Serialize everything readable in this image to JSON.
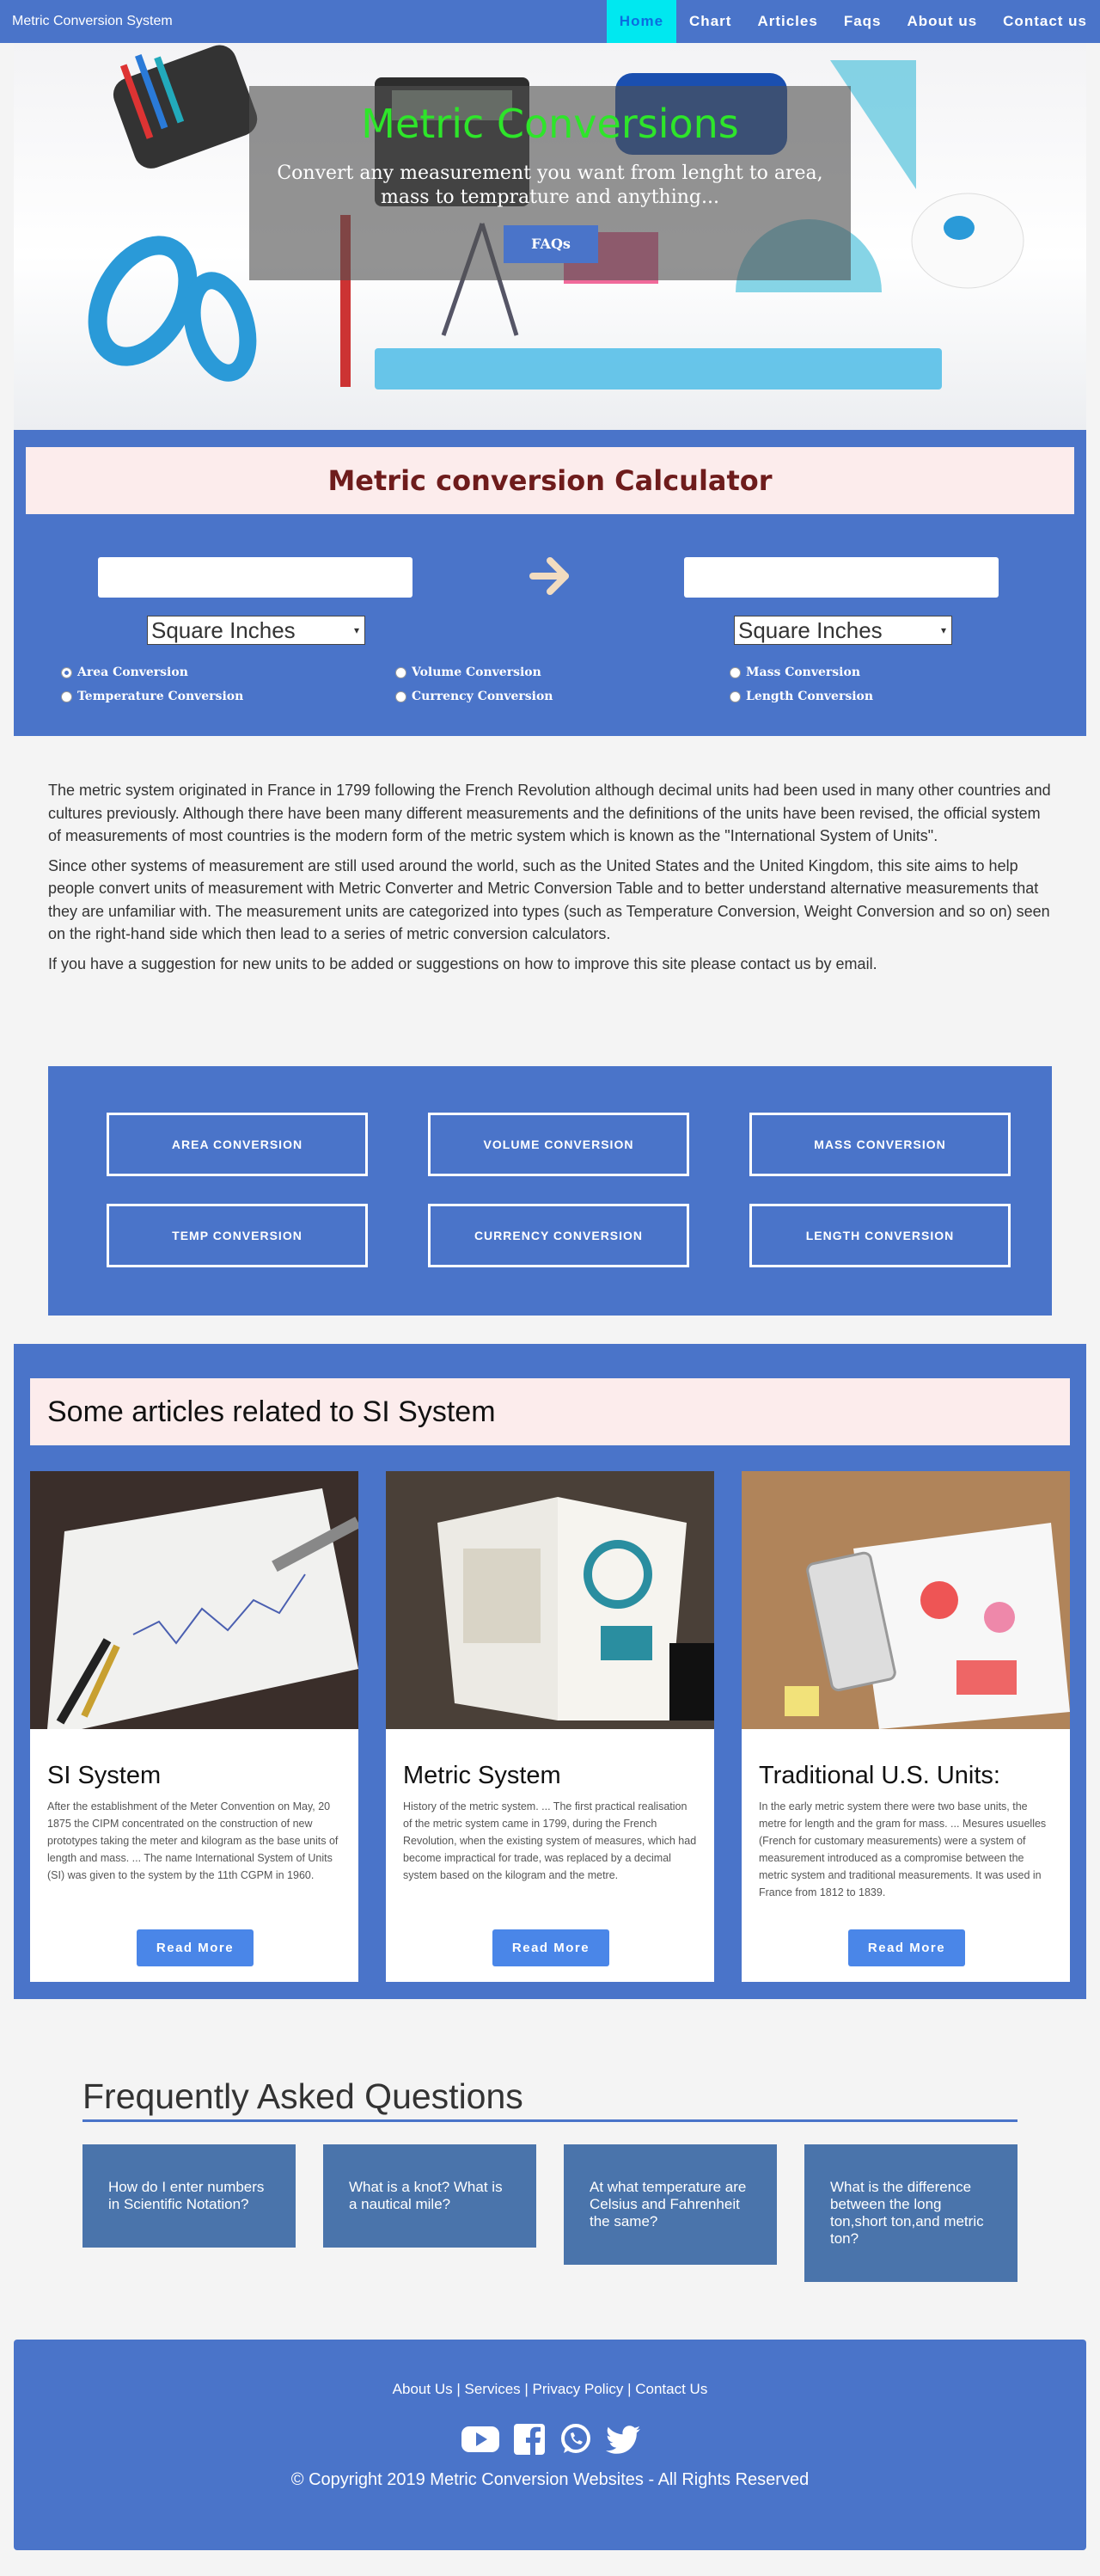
{
  "nav": {
    "brand": "Metric Conversion System",
    "links": [
      "Home",
      "Chart",
      "Articles",
      "Faqs",
      "About us",
      "Contact us"
    ]
  },
  "hero": {
    "title": "Metric Conversions",
    "subtitle_line1": "Convert any measurement you want from lenght to area,",
    "subtitle_line2": "mass to temprature and anything...",
    "button": "FAQs"
  },
  "calculator": {
    "title": "Metric conversion Calculator",
    "from_value": "",
    "to_value": "",
    "from_unit": "Square Inches",
    "to_unit": "Square Inches",
    "options": [
      {
        "label": "Area Conversion",
        "selected": true
      },
      {
        "label": "Volume Conversion",
        "selected": false
      },
      {
        "label": "Mass Conversion",
        "selected": false
      },
      {
        "label": "Temperature Conversion",
        "selected": false
      },
      {
        "label": "Currency Conversion",
        "selected": false
      },
      {
        "label": "Length Conversion",
        "selected": false
      }
    ]
  },
  "intro": {
    "p1": "The metric system originated in France in 1799 following the French Revolution although decimal units had been used in many other countries and cultures previously. Although there have been many different measurements and the definitions of the units have been revised, the official system of measurements of most countries is the modern form of the metric system which is known as the \"International System of Units\".",
    "p2": "Since other systems of measurement are still used around the world, such as the United States and the United Kingdom, this site aims to help people convert units of measurement with Metric Converter and Metric Conversion Table and to better understand alternative measurements that they are unfamiliar with. The measurement units are categorized into types (such as Temperature Conversion, Weight Conversion and so on) seen on the right-hand side which then lead to a series of metric conversion calculators.",
    "p3": "If you have a suggestion for new units to be added or suggestions on how to improve this site please contact us by email."
  },
  "conversions": [
    "AREA CONVERSION",
    "VOLUME CONVERSION",
    "MASS CONVERSION",
    "TEMP CONVERSION",
    "CURRENCY CONVERSION",
    "LENGTH CONVERSION"
  ],
  "articles": {
    "heading": "Some articles related to SI System",
    "cards": [
      {
        "title": "SI System",
        "text": "After the establishment of the Meter Convention on May, 20 1875 the CIPM concentrated on the construction of new prototypes taking the meter and kilogram as the base units of length and mass. ... The name International System of Units (SI) was given to the system by the 11th CGPM in 1960.",
        "button": "Read More"
      },
      {
        "title": "Metric System",
        "text": "History of the metric system. ... The first practical realisation of the metric system came in 1799, during the French Revolution, when the existing system of measures, which had become impractical for trade, was replaced by a decimal system based on the kilogram and the metre.",
        "button": "Read More"
      },
      {
        "title": "Traditional U.S. Units:",
        "text": "In the early metric system there were two base units, the metre for length and the gram for mass. ... Mesures usuelles (French for customary measurements) were a system of measurement introduced as a compromise between the metric system and traditional measurements. It was used in France from 1812 to 1839.",
        "button": "Read More"
      }
    ]
  },
  "faq": {
    "title": "Frequently Asked Questions",
    "items": [
      "How do I enter numbers in Scientific Notation?",
      "What is a knot? What is a nautical mile?",
      "At what temperature are Celsius and Fahrenheit the same?",
      "What is the difference between the long ton,short ton,and metric ton?"
    ]
  },
  "footer": {
    "links": [
      "About Us",
      "Services",
      "Privacy Policy",
      "Contact Us"
    ],
    "separator": " | ",
    "icons": [
      "youtube-icon",
      "facebook-icon",
      "whatsapp-icon",
      "twitter-icon"
    ],
    "copyright": "© Copyright 2019 Metric Conversion Websites - All Rights Reserved"
  },
  "colors": {
    "primary": "#4a74c9",
    "nav_active": "#00e8f0",
    "hero_title": "#2ee52a",
    "calc_title": "#6e1c1c",
    "panel_pink": "#fcecec",
    "faq_box": "#4a74ab",
    "read_more": "#4a86e8"
  }
}
